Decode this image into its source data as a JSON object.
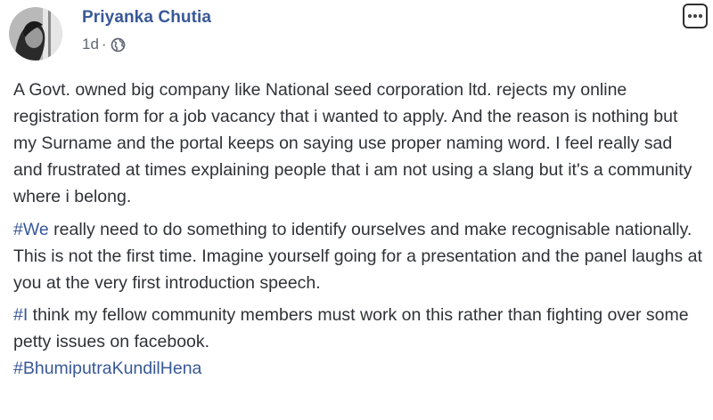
{
  "post": {
    "author": "Priyanka Chutia",
    "timestamp": "1d",
    "separator": "·",
    "privacy_icon": "globe-icon",
    "menu_icon": "more-options-icon",
    "paragraphs": [
      {
        "hashtag": "",
        "text": "A Govt. owned big company like National seed corporation ltd. rejects my online registration form for a job vacancy that i wanted to apply. And the reason is nothing but my Surname and the portal keeps on saying use proper naming word. I feel really sad and frustrated at times explaining people that i am not using a slang but it's a community where i belong."
      },
      {
        "hashtag": "#We",
        "text": " really need to do something to identify ourselves and make recognisable nationally. This is not the first time. Imagine yourself going for a presentation and the panel laughs at you at the very first introduction speech."
      },
      {
        "hashtag": "#I",
        "text": " think my fellow community members must work on this rather than fighting over some petty issues on facebook."
      }
    ],
    "final_hashtag": "#BhumiputraKundilHena"
  },
  "colors": {
    "link": "#385898",
    "text": "#2f3236",
    "meta": "#606770"
  }
}
